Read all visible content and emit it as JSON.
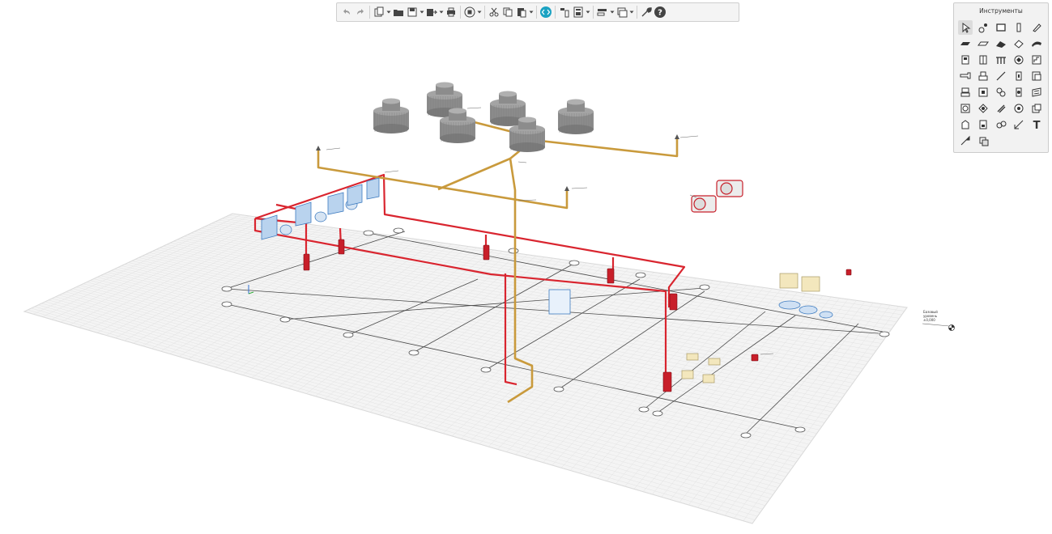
{
  "toolbar": {
    "buttons": [
      {
        "name": "undo-button",
        "icon": "undo-icon",
        "dropdown": false
      },
      {
        "name": "redo-button",
        "icon": "redo-icon",
        "dropdown": false
      },
      {
        "name": "new-project-button",
        "icon": "new-project-icon",
        "dropdown": true
      },
      {
        "name": "open-button",
        "icon": "folder-icon",
        "dropdown": false
      },
      {
        "name": "save-button",
        "icon": "save-icon",
        "dropdown": true
      },
      {
        "name": "export-button",
        "icon": "export-icon",
        "dropdown": true
      },
      {
        "name": "print-button",
        "icon": "printer-icon",
        "dropdown": false
      },
      {
        "name": "view-button",
        "icon": "view-cube-icon",
        "dropdown": true
      },
      {
        "name": "cut-button",
        "icon": "scissors-icon",
        "dropdown": false
      },
      {
        "name": "copy-button",
        "icon": "copy-icon",
        "dropdown": false
      },
      {
        "name": "paste-button",
        "icon": "paste-icon",
        "dropdown": true
      },
      {
        "name": "code-button",
        "icon": "code-icon",
        "dropdown": false
      },
      {
        "name": "properties-button",
        "icon": "properties-icon",
        "dropdown": false
      },
      {
        "name": "calculator-button",
        "icon": "calculator-icon",
        "dropdown": true
      },
      {
        "name": "layers-button",
        "icon": "layers-icon",
        "dropdown": true
      },
      {
        "name": "views-button",
        "icon": "windows-icon",
        "dropdown": true
      },
      {
        "name": "settings-button",
        "icon": "wrench-icon",
        "dropdown": false
      },
      {
        "name": "help-button",
        "icon": "help-icon",
        "dropdown": false
      }
    ]
  },
  "tools_panel": {
    "title": "Инструменты",
    "items": [
      "select-icon",
      "join-icon",
      "rectangle-icon",
      "column-icon",
      "pencil-icon",
      "slab-icon",
      "beam-icon",
      "roof-icon",
      "wall-icon",
      "curved-wall-icon",
      "door-icon",
      "window-icon",
      "railing-icon",
      "object-icon",
      "stair-icon",
      "duct-icon",
      "fitting-icon",
      "line-icon",
      "terminal-icon",
      "sheet-icon",
      "equipment-icon",
      "panel-icon",
      "fan-icon",
      "valve-icon",
      "damper-icon",
      "unit-icon",
      "boiler-icon",
      "pipe-icon",
      "pump-icon",
      "box-icon",
      "space-icon",
      "cabinet-icon",
      "generator-icon",
      "dimension-icon",
      "text-icon",
      "measure-icon",
      "copy-tool-icon"
    ],
    "text_tool_glyph": "T"
  },
  "level_marker": {
    "line1": "Базовый",
    "line2": "уровень",
    "line3": "±0,000"
  },
  "colors": {
    "grid_fill": "#f3f3f3",
    "grid_line": "#e0e0e0",
    "axis_line": "#555555",
    "red_pipe": "#d9252f",
    "gold_pipe": "#c99a3c",
    "tank": "#8a8a8a",
    "blue_equipment": "#6aa0d8",
    "cream_box": "#f3e7bd"
  }
}
